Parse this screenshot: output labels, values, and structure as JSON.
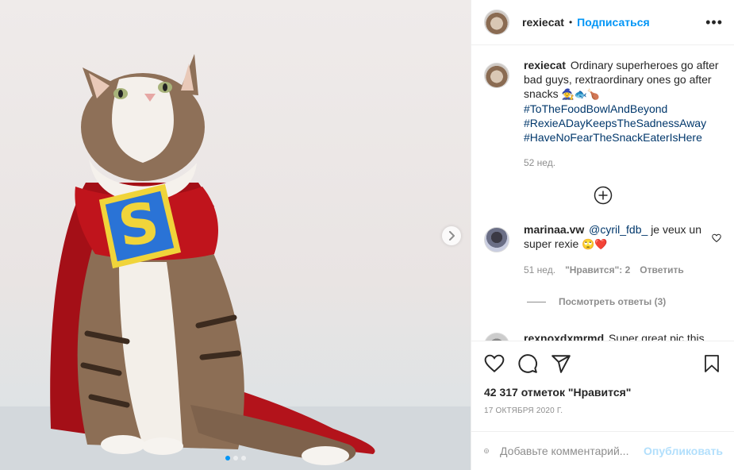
{
  "post": {
    "username": "rexiecat",
    "separator": "•",
    "follow_label": "Подписаться",
    "more_label": "•••"
  },
  "caption": {
    "username": "rexiecat",
    "text": "Ordinary superheroes go after bad guys, rextraordinary ones go after snacks",
    "emojis": "🧙🐟🍗",
    "hashtags": [
      "#ToTheFoodBowlAndBeyond",
      "#RexieADayKeepsTheSadnessAway",
      "#HaveNoFearTheSnackEaterIsHere"
    ],
    "time": "52 нед."
  },
  "comments": [
    {
      "username": "marinaa.vw",
      "mention": "@cyril_fdb_",
      "text": "je veux un super rexie",
      "emojis": "🙄❤️",
      "time": "51 нед.",
      "likes_label": "\"Нравится\": 2",
      "reply_label": "Ответить",
      "view_replies": "Посмотреть ответы (3)"
    },
    {
      "username": "rexnoxdxmrmd",
      "text": "Super great pic this"
    }
  ],
  "stats": {
    "likes": "42 317 отметок \"Нравится\"",
    "date": "17 октября 2020 г."
  },
  "add_comment": {
    "placeholder": "Добавьте комментарий...",
    "publish_label": "Опубликовать"
  },
  "icons": {
    "next": "chevron-right-icon",
    "load_more": "plus-circle-icon",
    "like": "heart-icon",
    "comment": "comment-icon",
    "share": "paper-plane-icon",
    "save": "bookmark-icon",
    "emoji": "smiley-icon"
  },
  "carousel": {
    "count": 3,
    "active": 0
  },
  "colors": {
    "accent": "#0095f6",
    "hashtag": "#00376b",
    "muted": "#8e8e8e",
    "publish_disabled": "#b2dffc",
    "cape": "#c0141c",
    "emblem_blue": "#2a73d6",
    "emblem_yellow": "#f0d43a"
  }
}
